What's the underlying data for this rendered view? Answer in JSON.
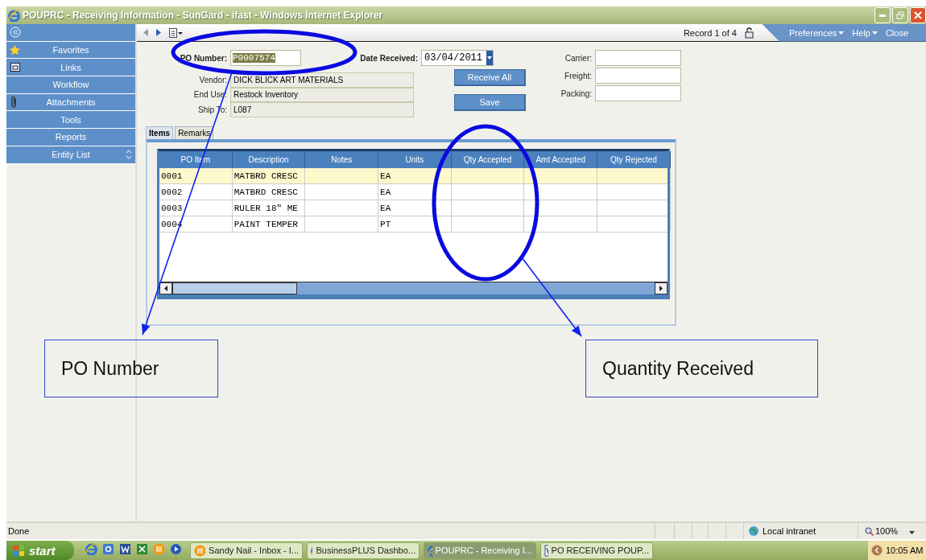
{
  "window": {
    "title": "POUPRC - Receiving Information - SunGard - ifast - Windows Internet Explorer"
  },
  "sidebar": {
    "items": [
      {
        "label": "Favorites"
      },
      {
        "label": "Links"
      },
      {
        "label": "Workflow"
      },
      {
        "label": "Attachments"
      },
      {
        "label": "Tools"
      },
      {
        "label": "Reports"
      },
      {
        "label": "Entity List"
      }
    ]
  },
  "toolbar": {
    "record": "Record 1 of 4",
    "menus": [
      {
        "label": "Preferences",
        "dropdown": true
      },
      {
        "label": "Help",
        "dropdown": true
      },
      {
        "label": "Close",
        "dropdown": false
      }
    ]
  },
  "form": {
    "po_number": {
      "label": "PO Number:",
      "value": "P0007574"
    },
    "date_received": {
      "label": "Date Received:",
      "value": "03/04/2011"
    },
    "details": [
      {
        "label": "Vendor:",
        "value": "DICK BLICK ART MATERIALS"
      },
      {
        "label": "End Use:",
        "value": "Restock Inventory"
      },
      {
        "label": "Ship To:",
        "value": "L087"
      }
    ],
    "buttons": [
      "Receive All",
      "Save"
    ],
    "shipping": [
      {
        "label": "Carrier:"
      },
      {
        "label": "Freight:"
      },
      {
        "label": "Packing:"
      }
    ]
  },
  "tabs": [
    {
      "label": "Items",
      "selected": true
    },
    {
      "label": "Remarks",
      "selected": false
    }
  ],
  "table": {
    "columns": [
      "PO Item",
      "Description",
      "Notes",
      "Units",
      "Qty Accepted",
      "Amt Accepted",
      "Qty Rejected"
    ],
    "rows": [
      {
        "po_item": "0001",
        "description": "MATBRD CRESC",
        "units": "EA",
        "selected": true
      },
      {
        "po_item": "0002",
        "description": "MATBRD CRESC",
        "units": "EA",
        "selected": false
      },
      {
        "po_item": "0003",
        "description": "RULER 18\" ME",
        "units": "EA",
        "selected": false
      },
      {
        "po_item": "0004",
        "description": "PAINT TEMPER",
        "units": "PT",
        "selected": false
      }
    ]
  },
  "annotations": [
    {
      "label": "PO Number"
    },
    {
      "label": "Quantity Received"
    }
  ],
  "status_bar": {
    "text": "Done",
    "zone": "Local intranet",
    "zoom": "100%"
  },
  "taskbar": {
    "start": "start",
    "tasks": [
      {
        "label": "Sandy Nail - Inbox - I...",
        "selected": false
      },
      {
        "label": "BusinessPLUS Dashbo...",
        "selected": false
      },
      {
        "label": "POUPRC - Receiving I...",
        "selected": true
      },
      {
        "label": "PO RECEIVING POUP...",
        "selected": false
      }
    ],
    "clock": "10:05 AM"
  }
}
